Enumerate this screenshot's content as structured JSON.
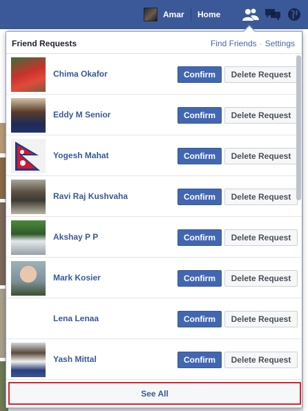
{
  "topbar": {
    "user_name": "Amar",
    "home_label": "Home",
    "brand_color": "#3b5998",
    "icons": [
      "friend-requests-icon",
      "messages-icon",
      "notifications-globe-icon"
    ]
  },
  "panel": {
    "title": "Friend Requests",
    "find_friends_label": "Find Friends",
    "link_separator": "·",
    "settings_label": "Settings",
    "confirm_label": "Confirm",
    "delete_label": "Delete Request",
    "see_all_label": "See All",
    "requests": [
      {
        "name": "Chima Okafor"
      },
      {
        "name": "Eddy M Senior"
      },
      {
        "name": "Yogesh Mahat"
      },
      {
        "name": "Ravi Raj Kushvaha"
      },
      {
        "name": "Akshay P P"
      },
      {
        "name": "Mark Kosier"
      },
      {
        "name": "Lena Lenaa"
      },
      {
        "name": "Yash Mittal"
      }
    ]
  }
}
